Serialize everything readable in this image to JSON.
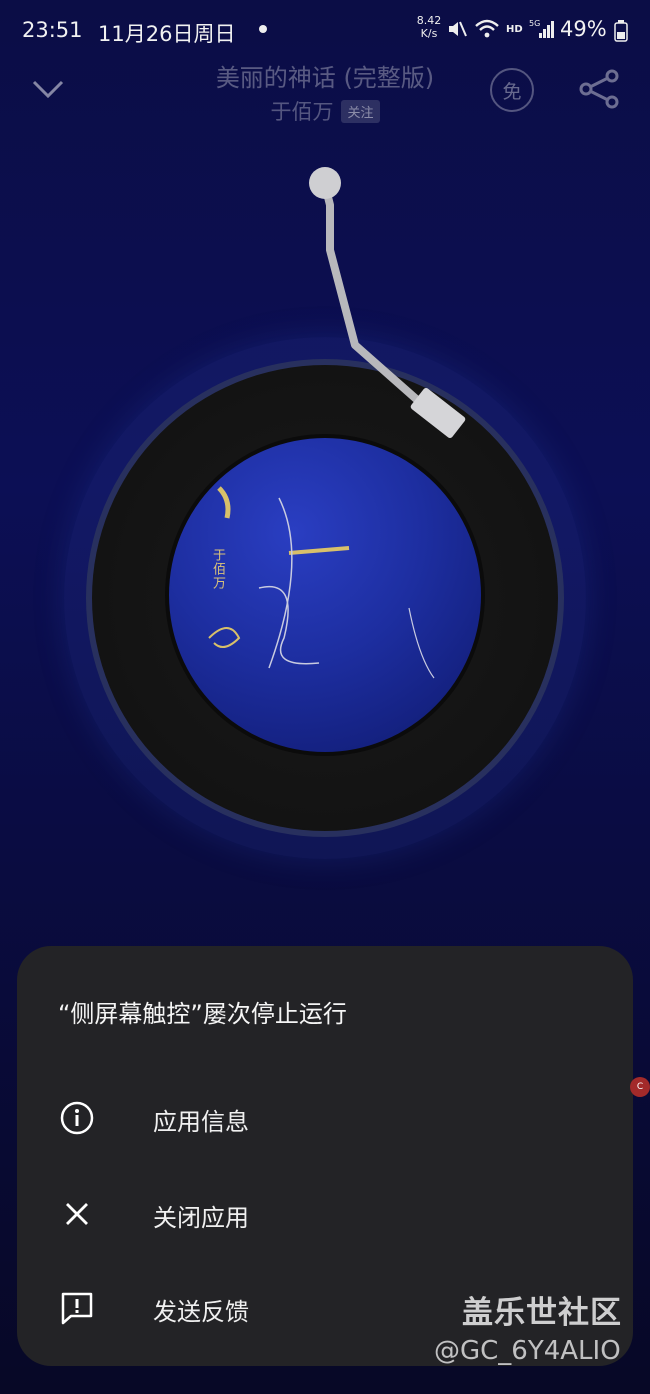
{
  "status_bar": {
    "time": "23:51",
    "date": "11月26日周日",
    "net_speed_value": "8.42",
    "net_speed_unit": "K/s",
    "network_hd": "HD",
    "network_gen": "5G",
    "battery_text": "49%"
  },
  "player": {
    "song_title": "美丽的神话 (完整版)",
    "artist": "于佰万",
    "follow_label": "关注",
    "free_badge": "免",
    "cover_artist_text": "于佰万"
  },
  "dialog": {
    "title": "“侧屏幕触控”屡次停止运行",
    "items": [
      {
        "label": "应用信息",
        "icon": "info-icon"
      },
      {
        "label": "关闭应用",
        "icon": "close-icon"
      },
      {
        "label": "发送反馈",
        "icon": "feedback-icon"
      }
    ]
  },
  "watermark": {
    "site": "盖乐世社区",
    "user": "@GC_6Y4ALIO"
  },
  "edge_badge": "C"
}
